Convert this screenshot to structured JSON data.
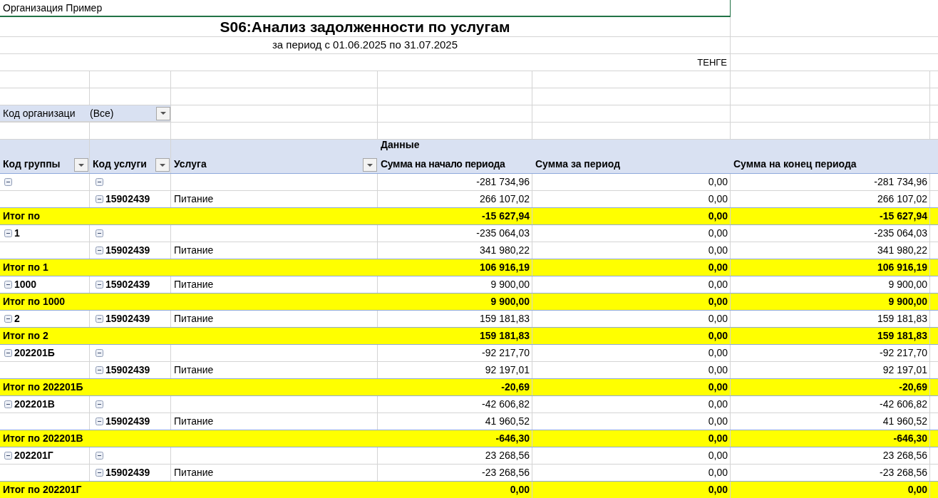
{
  "organization": "Организация Пример",
  "title": "S06:Анализ задолженности по услугам",
  "subtitle": "за период с 01.06.2025 по 31.07.2025",
  "currency": "ТЕНГЕ",
  "filter": {
    "label": "Код организаци",
    "value": "(Все)"
  },
  "header": {
    "data_caption": "Данные",
    "columns": [
      "Код группы",
      "Код услуги",
      "Услуга",
      "Сумма  на начало периода",
      "Сумма за период",
      "Сумма на конец периода"
    ]
  },
  "rows": [
    {
      "kind": "item",
      "group": {
        "expanded": true
      },
      "code": {
        "expanded": true
      },
      "values": [
        "-281 734,96",
        "0,00",
        "-281 734,96"
      ]
    },
    {
      "kind": "item",
      "code": {
        "label": "15902439",
        "expanded": true
      },
      "service": "Питание",
      "values": [
        "266 107,02",
        "0,00",
        "266 107,02"
      ]
    },
    {
      "kind": "total",
      "label": "Итог по",
      "values": [
        "-15 627,94",
        "0,00",
        "-15 627,94"
      ]
    },
    {
      "kind": "item",
      "group": {
        "label": "1",
        "expanded": true
      },
      "code": {
        "expanded": true
      },
      "values": [
        "-235 064,03",
        "0,00",
        "-235 064,03"
      ]
    },
    {
      "kind": "item",
      "code": {
        "label": "15902439",
        "expanded": true
      },
      "service": "Питание",
      "values": [
        "341 980,22",
        "0,00",
        "341 980,22"
      ]
    },
    {
      "kind": "total",
      "label": "Итог по 1",
      "values": [
        "106 916,19",
        "0,00",
        "106 916,19"
      ]
    },
    {
      "kind": "item",
      "group": {
        "label": "1000",
        "expanded": true
      },
      "code": {
        "label": "15902439",
        "expanded": true
      },
      "service": "Питание",
      "values": [
        "9 900,00",
        "0,00",
        "9 900,00"
      ]
    },
    {
      "kind": "total",
      "label": "Итог по 1000",
      "values": [
        "9 900,00",
        "0,00",
        "9 900,00"
      ]
    },
    {
      "kind": "item",
      "group": {
        "label": "2",
        "expanded": true
      },
      "code": {
        "label": "15902439",
        "expanded": true
      },
      "service": "Питание",
      "values": [
        "159 181,83",
        "0,00",
        "159 181,83"
      ]
    },
    {
      "kind": "total",
      "label": "Итог по 2",
      "values": [
        "159 181,83",
        "0,00",
        "159 181,83"
      ]
    },
    {
      "kind": "item",
      "group": {
        "label": "202201Б",
        "expanded": true
      },
      "code": {
        "expanded": true
      },
      "values": [
        "-92 217,70",
        "0,00",
        "-92 217,70"
      ]
    },
    {
      "kind": "item",
      "code": {
        "label": "15902439",
        "expanded": true
      },
      "service": "Питание",
      "values": [
        "92 197,01",
        "0,00",
        "92 197,01"
      ]
    },
    {
      "kind": "total",
      "label": "Итог по 202201Б",
      "values": [
        "-20,69",
        "0,00",
        "-20,69"
      ]
    },
    {
      "kind": "item",
      "group": {
        "label": "202201В",
        "expanded": true
      },
      "code": {
        "expanded": true
      },
      "values": [
        "-42 606,82",
        "0,00",
        "-42 606,82"
      ]
    },
    {
      "kind": "item",
      "code": {
        "label": "15902439",
        "expanded": true
      },
      "service": "Питание",
      "values": [
        "41 960,52",
        "0,00",
        "41 960,52"
      ]
    },
    {
      "kind": "total",
      "label": "Итог по 202201В",
      "values": [
        "-646,30",
        "0,00",
        "-646,30"
      ]
    },
    {
      "kind": "item",
      "group": {
        "label": "202201Г",
        "expanded": true
      },
      "code": {
        "expanded": true
      },
      "values": [
        "23 268,56",
        "0,00",
        "23 268,56"
      ]
    },
    {
      "kind": "item",
      "code": {
        "label": "15902439",
        "expanded": true
      },
      "service": "Питание",
      "values": [
        "-23 268,56",
        "0,00",
        "-23 268,56"
      ]
    },
    {
      "kind": "total",
      "label": "Итог по 202201Г",
      "values": [
        "0,00",
        "0,00",
        "0,00"
      ]
    }
  ]
}
